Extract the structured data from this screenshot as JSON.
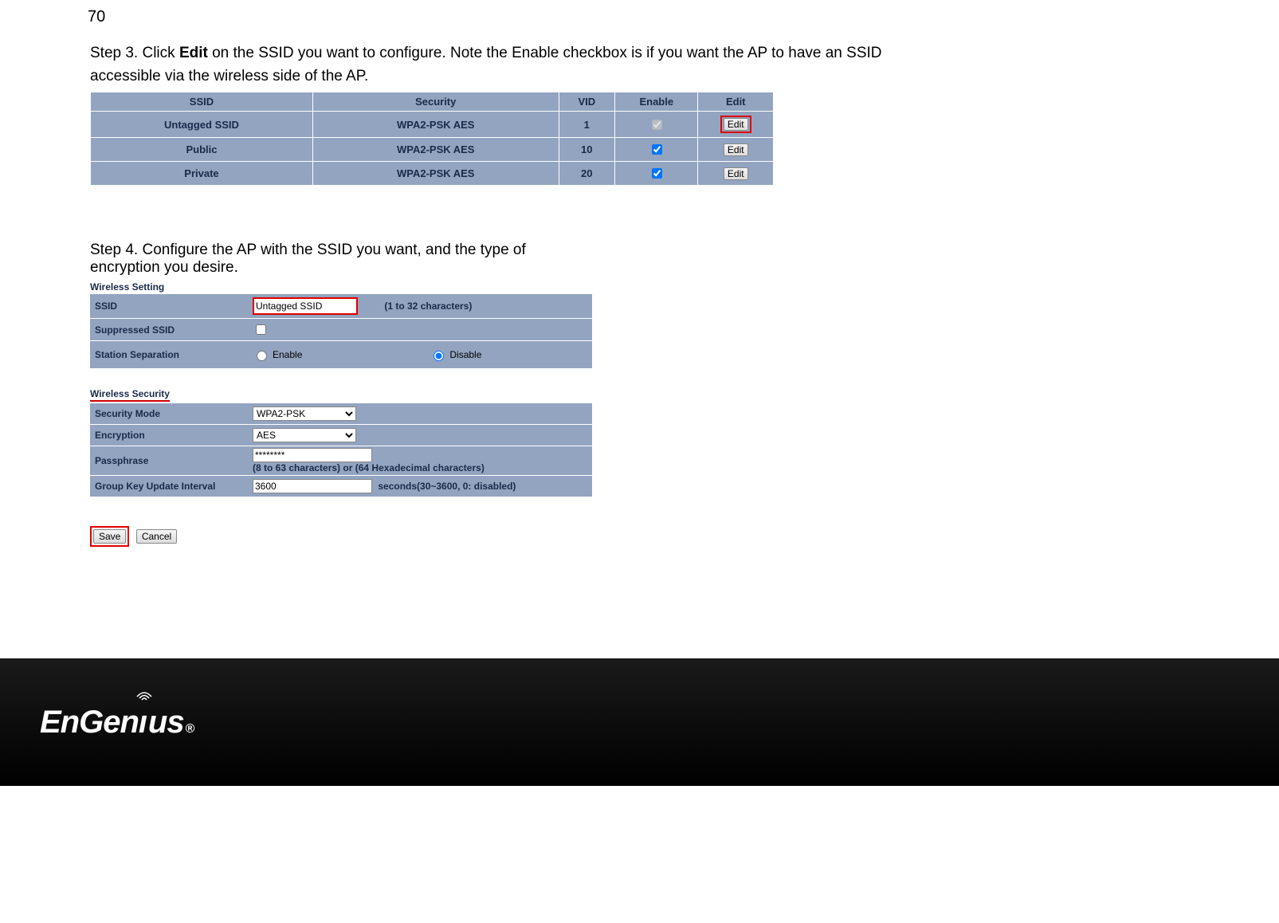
{
  "page_number": "70",
  "step3": {
    "prefix": "Step 3. Click ",
    "bold": "Edit",
    "suffix": " on the SSID you want to configure. Note the Enable checkbox is if you want the AP to have an SSID accessible via the wireless side of the AP."
  },
  "ssid_table": {
    "headers": {
      "ssid": "SSID",
      "security": "Security",
      "vid": "VID",
      "enable": "Enable",
      "edit": "Edit"
    },
    "rows": [
      {
        "ssid": "Untagged SSID",
        "security": "WPA2-PSK AES",
        "vid": "1",
        "enabled": true,
        "highlight": true,
        "disabled_cb": true
      },
      {
        "ssid": "Public",
        "security": "WPA2-PSK AES",
        "vid": "10",
        "enabled": true,
        "highlight": false,
        "disabled_cb": false
      },
      {
        "ssid": "Private",
        "security": "WPA2-PSK AES",
        "vid": "20",
        "enabled": true,
        "highlight": false,
        "disabled_cb": false
      }
    ],
    "edit_label": "Edit"
  },
  "step4": "Step 4. Configure the AP with the SSID you want, and the type of encryption you desire.",
  "wireless_setting": {
    "heading": "Wireless Setting",
    "ssid": {
      "label": "SSID",
      "value": "Untagged SSID",
      "hint": "(1 to 32 characters)"
    },
    "suppressed": {
      "label": "Suppressed SSID",
      "checked": false
    },
    "separation": {
      "label": "Station Separation",
      "enable": "Enable",
      "disable": "Disable",
      "selected": "disable"
    }
  },
  "wireless_security": {
    "heading": "Wireless Security",
    "mode": {
      "label": "Security Mode",
      "value": "WPA2-PSK"
    },
    "encryption": {
      "label": "Encryption",
      "value": "AES"
    },
    "passphrase": {
      "label": "Passphrase",
      "value": "********",
      "hint": "(8 to 63 characters) or (64 Hexadecimal characters)"
    },
    "group_key": {
      "label": "Group Key Update Interval",
      "value": "3600",
      "hint": "seconds(30~3600, 0: disabled)"
    }
  },
  "buttons": {
    "save": "Save",
    "cancel": "Cancel"
  },
  "brand": {
    "name": "EnGenius",
    "reg": "®"
  }
}
